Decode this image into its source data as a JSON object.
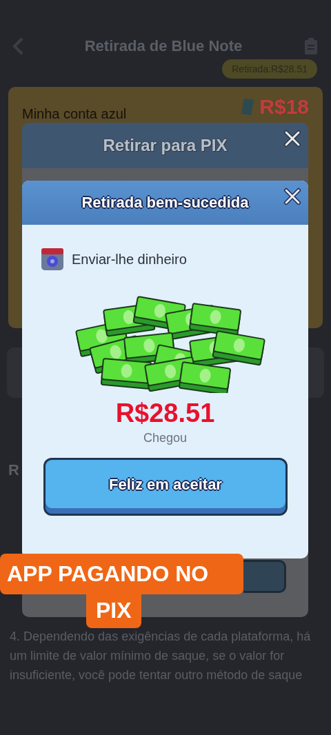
{
  "header": {
    "title": "Retirada de Blue Note",
    "badge": "Retirada:R$28.51"
  },
  "account_card": {
    "label": "Minha conta azul",
    "amount": "R$18"
  },
  "section_heading": "R",
  "note": "4. Dependendo das exigências de cada plataforma, há um limite de valor mínimo de saque, se o valor for insuficiente, você pode tentar outro método de saque",
  "pix_dialog": {
    "title": "Retirar para PIX"
  },
  "success_dialog": {
    "title": "Retirada bem-sucedida",
    "sender": "Enviar-lhe dinheiro",
    "amount": "R$28.51",
    "status": "Chegou",
    "button": "Feliz em aceitar"
  },
  "caption": {
    "lines": [
      "APP PAGANDO NO",
      "PIX"
    ]
  }
}
